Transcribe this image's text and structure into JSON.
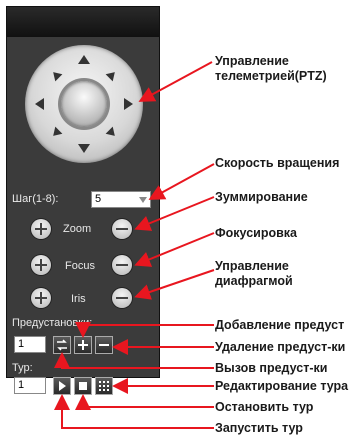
{
  "ptz": {
    "speed_label": "Шаг(1-8):",
    "speed_value": "5",
    "zoom_label": "Zoom",
    "focus_label": "Focus",
    "iris_label": "Iris",
    "preset_label": "Предустановки:",
    "preset_value": "1",
    "tour_label": "Тур:",
    "tour_value": "1"
  },
  "annotations": {
    "ptz_control_line1": "Управление",
    "ptz_control_line2": "телеметрией(PTZ)",
    "rotation_speed": "Скорость вращения",
    "zoom": "Зуммирование",
    "focus": "Фокусировка",
    "iris_line1": "Управление",
    "iris_line2": "диафрагмой",
    "add_preset": "Добавление предуст",
    "delete_preset": "Удаление предуст-ки",
    "call_preset": "Вызов предуст-ки",
    "edit_tour": "Редактирование тура",
    "stop_tour": "Остановить тур",
    "start_tour": "Запустить тур"
  },
  "colors": {
    "arrow": "#e8161f",
    "panel": "#3b3b3b"
  },
  "icons": [
    "up-arrow-icon",
    "down-arrow-icon",
    "left-arrow-icon",
    "right-arrow-icon",
    "plus-icon",
    "minus-icon",
    "goto-icon",
    "play-icon",
    "stop-icon",
    "grid-icon"
  ]
}
